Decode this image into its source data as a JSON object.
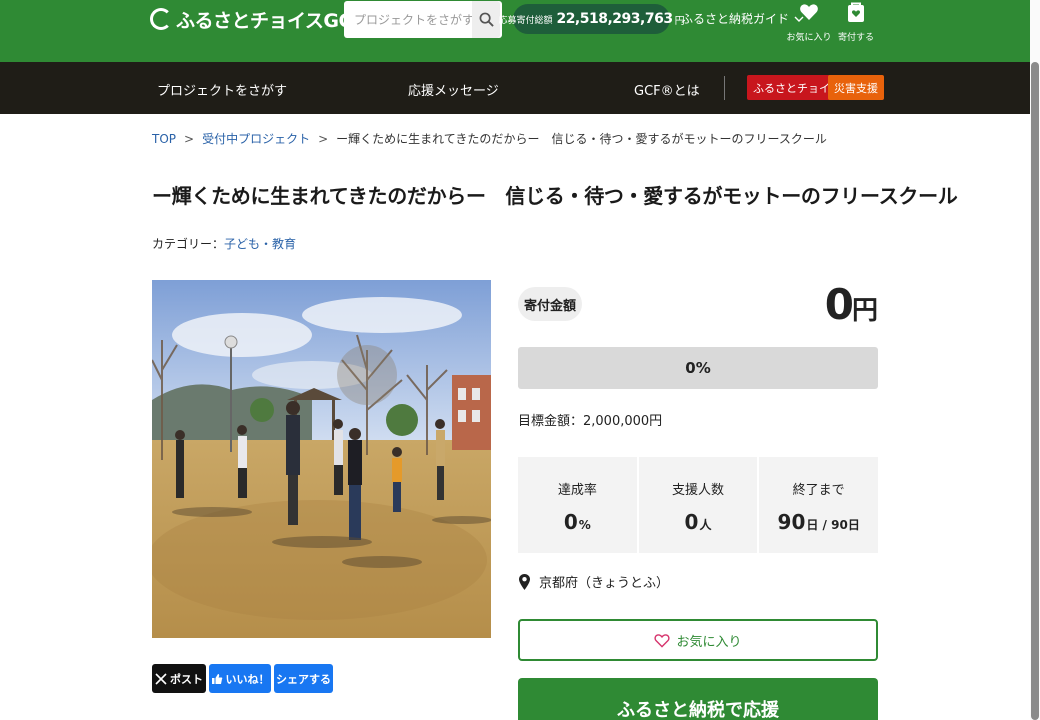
{
  "header": {
    "logo_text": "ふるさとチョイスGCF",
    "logo_mark": "®",
    "search_placeholder": "プロジェクトをさがす",
    "total_label": "応募寄付総額",
    "total_amount": "22,518,293,763",
    "total_unit": "円",
    "guide_label": "ふるさと納税ガイド",
    "favorites_label": "お気に入り",
    "donate_label": "寄付する",
    "brand_color": "#2f8a34"
  },
  "nav": {
    "items": [
      "プロジェクトをさがす",
      "応援メッセージ",
      "GCF®とは"
    ],
    "badge_choice": "ふるさとチョイス",
    "badge_disaster": "災害支援",
    "badge_choice_color": "#c8161d",
    "badge_disaster_color": "#e8620b"
  },
  "breadcrumb": {
    "top": "TOP",
    "accepting": "受付中プロジェクト",
    "current": "ー輝くために生まれてきたのだからー　信じる・待つ・愛するがモットーのフリースクール"
  },
  "project": {
    "title": "ー輝くために生まれてきたのだからー　信じる・待つ・愛するがモットーのフリースクール",
    "category_label": "カテゴリー：",
    "category_value": "子ども・教育"
  },
  "share": {
    "x_label": "ポスト",
    "like_label": "いいね！",
    "share_label": "シェアする"
  },
  "funding": {
    "donation_label": "寄付金額",
    "amount": "0",
    "amount_unit": "円",
    "progress_fraction": 0,
    "progress_text": "0%",
    "goal_text": "目標金額：2,000,000円",
    "stats": [
      {
        "label": "達成率",
        "value": "0",
        "unit": "%"
      },
      {
        "label": "支援人数",
        "value": "0",
        "unit": "人"
      },
      {
        "label": "終了まで",
        "value": "90",
        "unit": "日 / 90日"
      }
    ],
    "location": "京都府（きょうとふ）",
    "favorite_button": "お気に入り",
    "support_button": "ふるさと納税で応援"
  }
}
